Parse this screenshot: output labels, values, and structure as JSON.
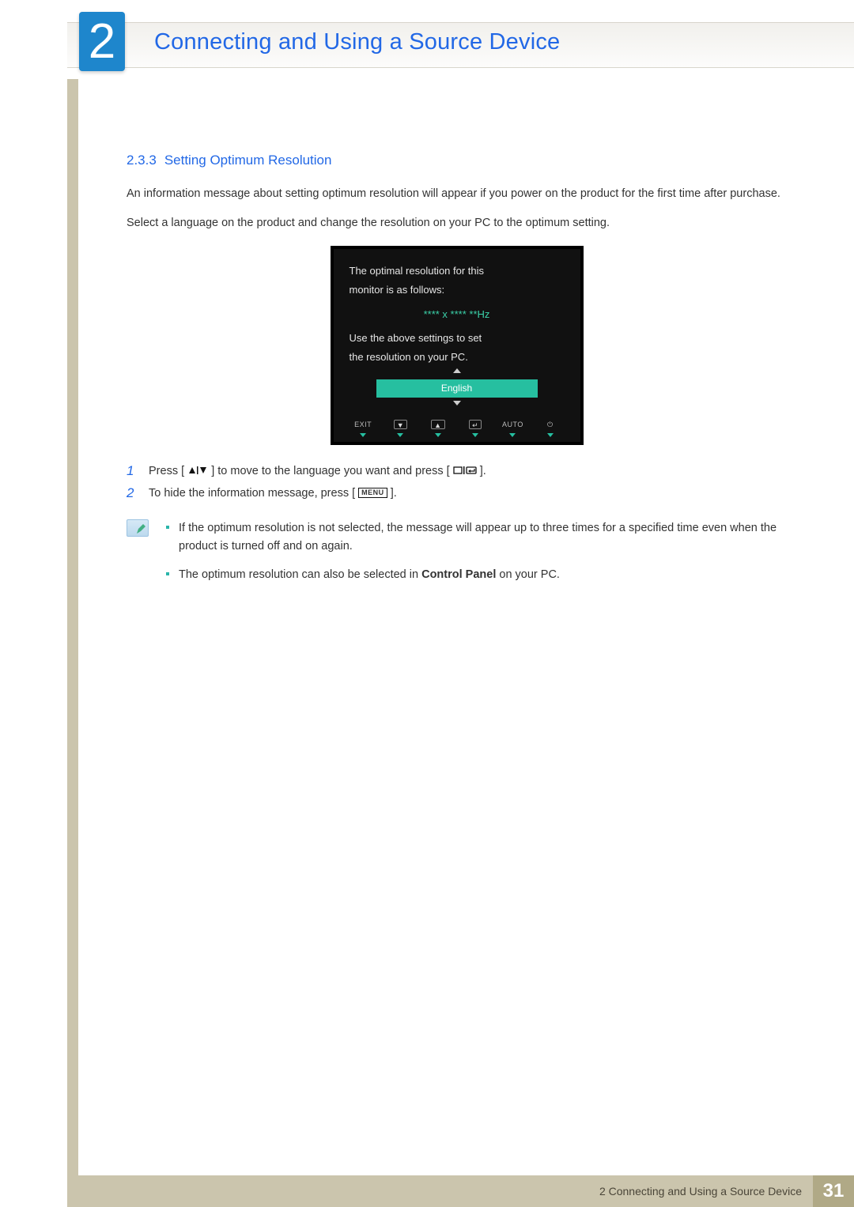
{
  "header": {
    "chapter_number": "2",
    "chapter_title": "Connecting and Using a Source Device"
  },
  "section": {
    "number": "2.3.3",
    "title": "Setting Optimum Resolution"
  },
  "paragraphs": {
    "p1": "An information message about setting optimum resolution will appear if you power on the product for the first time after purchase.",
    "p2": "Select a language on the product and change the resolution on your PC to the optimum setting."
  },
  "osd": {
    "line1": "The optimal resolution for this",
    "line2": "monitor is as follows:",
    "resolution": "**** x ****  **Hz",
    "line3": "Use the above settings to set",
    "line4": "the resolution on your PC.",
    "selected_language": "English",
    "buttons": {
      "exit": "EXIT",
      "auto": "AUTO"
    }
  },
  "steps": {
    "s1_a": "Press [",
    "s1_b": "] to move to the language you want and press [",
    "s1_c": "].",
    "s2_a": "To hide the information message, press [",
    "s2_b": "].",
    "menu_label": "MENU"
  },
  "notes": {
    "n1": "If the optimum resolution is not selected, the message will appear up to three times for a specified time even when the product is turned off and on again.",
    "n2_a": "The optimum resolution can also be selected in ",
    "n2_bold": "Control Panel",
    "n2_b": " on your PC."
  },
  "footer": {
    "text": "2 Connecting and Using a Source Device",
    "page": "31"
  }
}
